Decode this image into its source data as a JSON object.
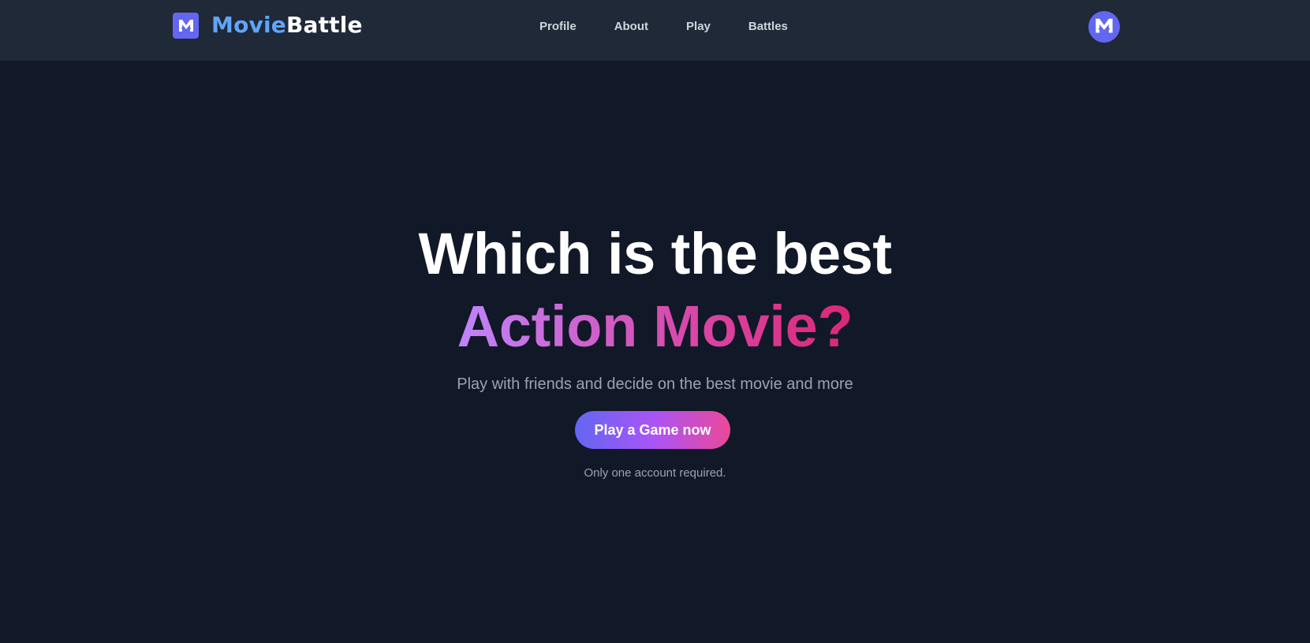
{
  "header": {
    "brand": {
      "part1": "Movie",
      "part2": "Battle",
      "logo_icon": "m-logo-icon",
      "part1_color": "#60a5fa",
      "part2_color": "#ffffff"
    },
    "nav": [
      {
        "label": "Profile"
      },
      {
        "label": "About"
      },
      {
        "label": "Play"
      },
      {
        "label": "Battles"
      }
    ],
    "avatar_icon": "m-logo-icon"
  },
  "hero": {
    "line1": "Which is the best",
    "line2": "Action Movie?",
    "subtitle": "Play with friends and decide on the best movie and more",
    "cta_label": "Play a Game now",
    "note": "Only one account required."
  },
  "colors": {
    "background": "#111827",
    "navbar": "#1f2937",
    "accent": "#6366f1",
    "gradient_start": "#c084fc",
    "gradient_end": "#db2777"
  }
}
